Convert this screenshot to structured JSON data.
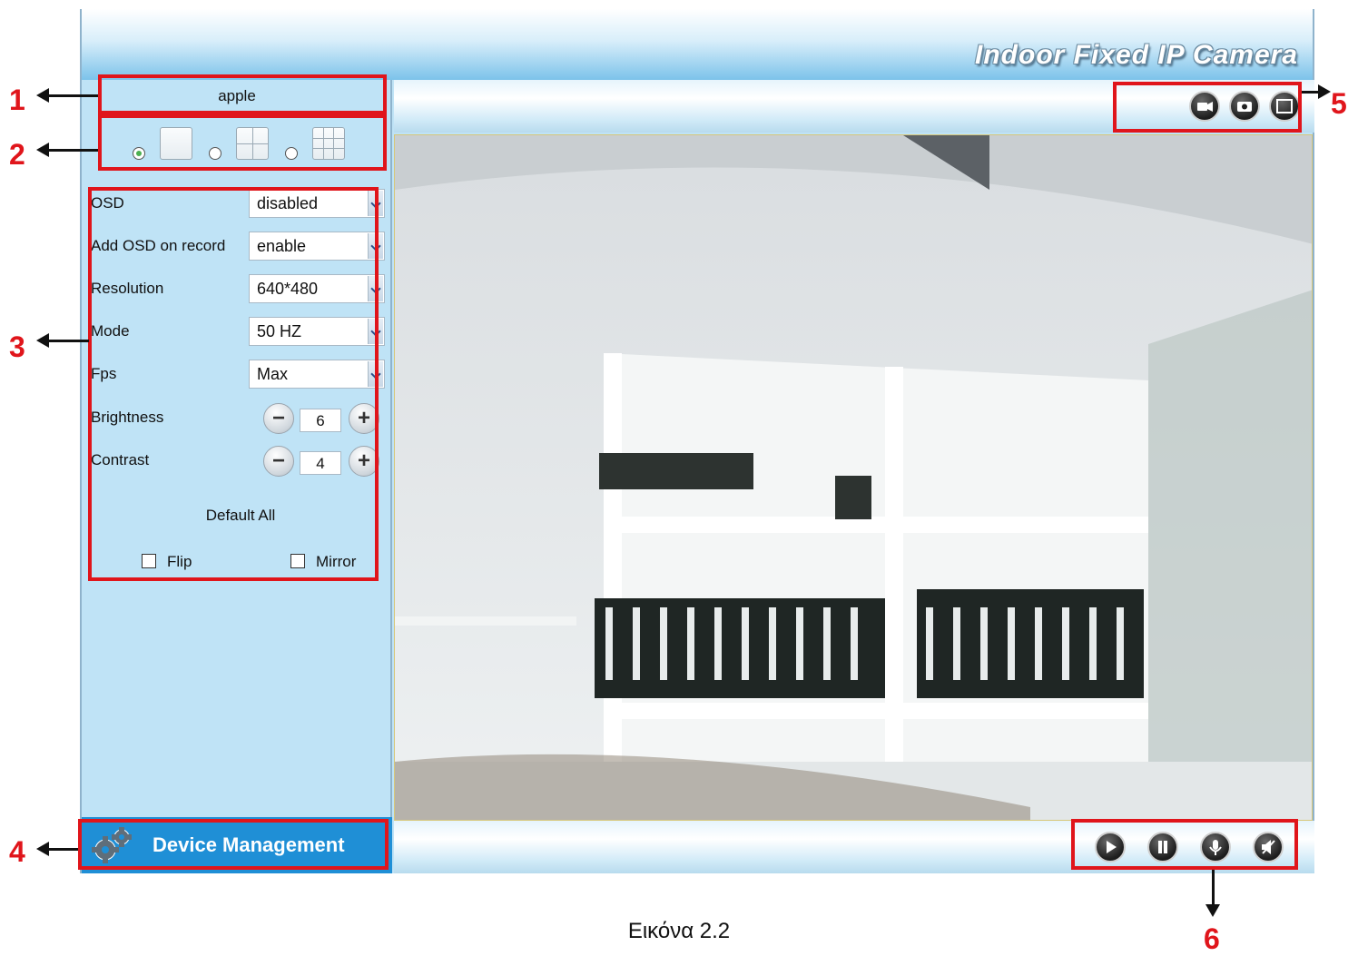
{
  "header": {
    "title": "Indoor Fixed IP Camera"
  },
  "sidebar": {
    "device_name": "apple",
    "layouts": [
      {
        "name": "1-view",
        "selected": true
      },
      {
        "name": "4-view",
        "selected": false
      },
      {
        "name": "9-view",
        "selected": false
      }
    ],
    "settings": {
      "osd": {
        "label": "OSD",
        "value": "disabled"
      },
      "add_osd_on_record": {
        "label": "Add OSD on record",
        "value": "enable"
      },
      "resolution": {
        "label": "Resolution",
        "value": "640*480"
      },
      "mode": {
        "label": "Mode",
        "value": "50 HZ"
      },
      "fps": {
        "label": "Fps",
        "value": "Max"
      },
      "brightness": {
        "label": "Brightness",
        "value": "6",
        "minus": "−",
        "plus": "+"
      },
      "contrast": {
        "label": "Contrast",
        "value": "4",
        "minus": "−",
        "plus": "+"
      },
      "default_all": "Default All",
      "flip": {
        "label": "Flip",
        "checked": false
      },
      "mirror": {
        "label": "Mirror",
        "checked": false
      }
    },
    "device_management": {
      "label": "Device Management",
      "icon": "gear-icon"
    }
  },
  "toolbar_top": {
    "icons": [
      "record-icon",
      "snapshot-icon",
      "fullscreen-icon"
    ]
  },
  "toolbar_bottom": {
    "icons": [
      "play-icon",
      "pause-icon",
      "microphone-icon",
      "speaker-icon"
    ]
  },
  "annotations": [
    "1",
    "2",
    "3",
    "4",
    "5",
    "6"
  ],
  "caption": "Εικόνα 2.2",
  "colors": {
    "accent": "#1f8fd6",
    "annotation": "#e0151b",
    "sidebar_bg": "#bfe3f6"
  }
}
